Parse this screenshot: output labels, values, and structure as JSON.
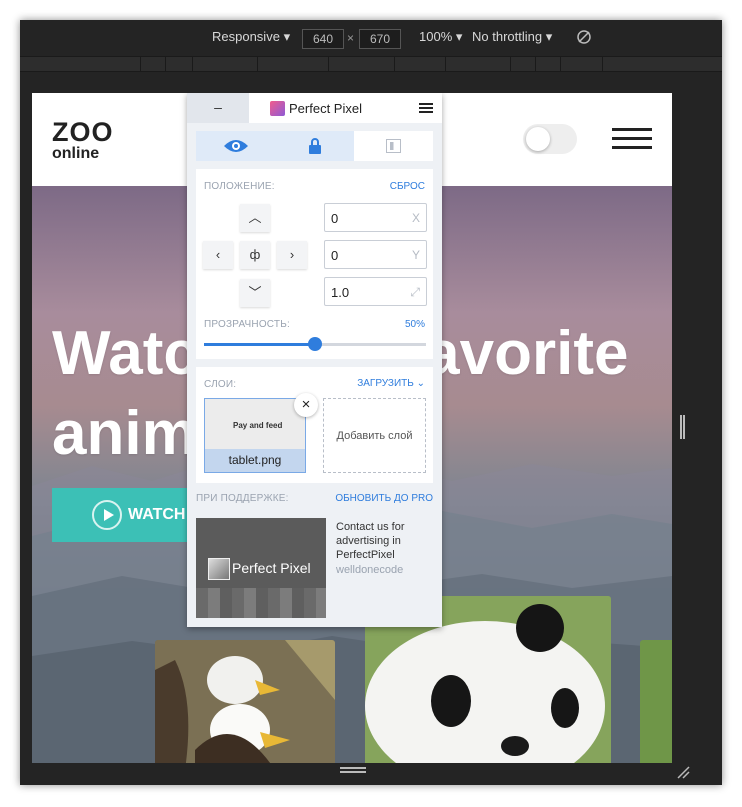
{
  "devtools": {
    "device": "Responsive",
    "width": "640",
    "times": "×",
    "height": "670",
    "zoom": "100%",
    "throttle": "No throttling",
    "rotate_icon": "rotate-icon"
  },
  "site": {
    "logo_top": "ZOO",
    "logo_bottom": "online",
    "hero_line1": "Watch your favorite",
    "hero_line2": "animals",
    "watch_label": "WATCH"
  },
  "pp": {
    "minimize": "–",
    "title": "Perfect Pixel",
    "position_label": "ПОЛОЖЕНИЕ:",
    "reset": "СБРОС",
    "center_symbol": "ф",
    "x_value": "0",
    "x_suffix": "X",
    "y_value": "0",
    "y_suffix": "Y",
    "scale_value": "1.0",
    "opacity_label": "ПРОЗРАЧНОСТЬ:",
    "opacity_value": "50%",
    "opacity_fraction": 0.5,
    "layers_label": "СЛОИ:",
    "upload": "ЗАГРУЗИТЬ",
    "layer_name": "tablet.png",
    "layer_thumb_title": "Pay and feed",
    "add_layer": "Добавить слой",
    "support_label": "ПРИ ПОДДЕРЖКЕ:",
    "upgrade": "ОБНОВИТЬ ДО PRO",
    "ad_title": "Perfect Pixel",
    "ad_text": "Contact us for advertising in PerfectPixel",
    "ad_brand": "welldonecode"
  },
  "colors": {
    "accent": "#2f7ddd",
    "watch": "#3cc0b6",
    "devtools_bg": "#242424"
  }
}
